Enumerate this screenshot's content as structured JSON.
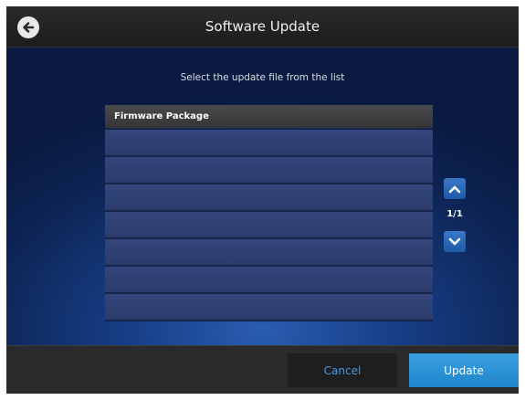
{
  "header": {
    "title": "Software Update",
    "back_icon": "back-arrow-icon"
  },
  "main": {
    "instruction": "Select the update file from the list",
    "list": {
      "column_header": "Firmware Package",
      "rows": [
        "",
        "",
        "",
        "",
        "",
        "",
        ""
      ]
    },
    "pager": {
      "up_icon": "chevron-up-icon",
      "down_icon": "chevron-down-icon",
      "page_label": "1/1"
    }
  },
  "footer": {
    "cancel_label": "Cancel",
    "update_label": "Update"
  },
  "colors": {
    "accent": "#2f94d8",
    "background": "#0b1a3e",
    "row": "#2f4175"
  }
}
